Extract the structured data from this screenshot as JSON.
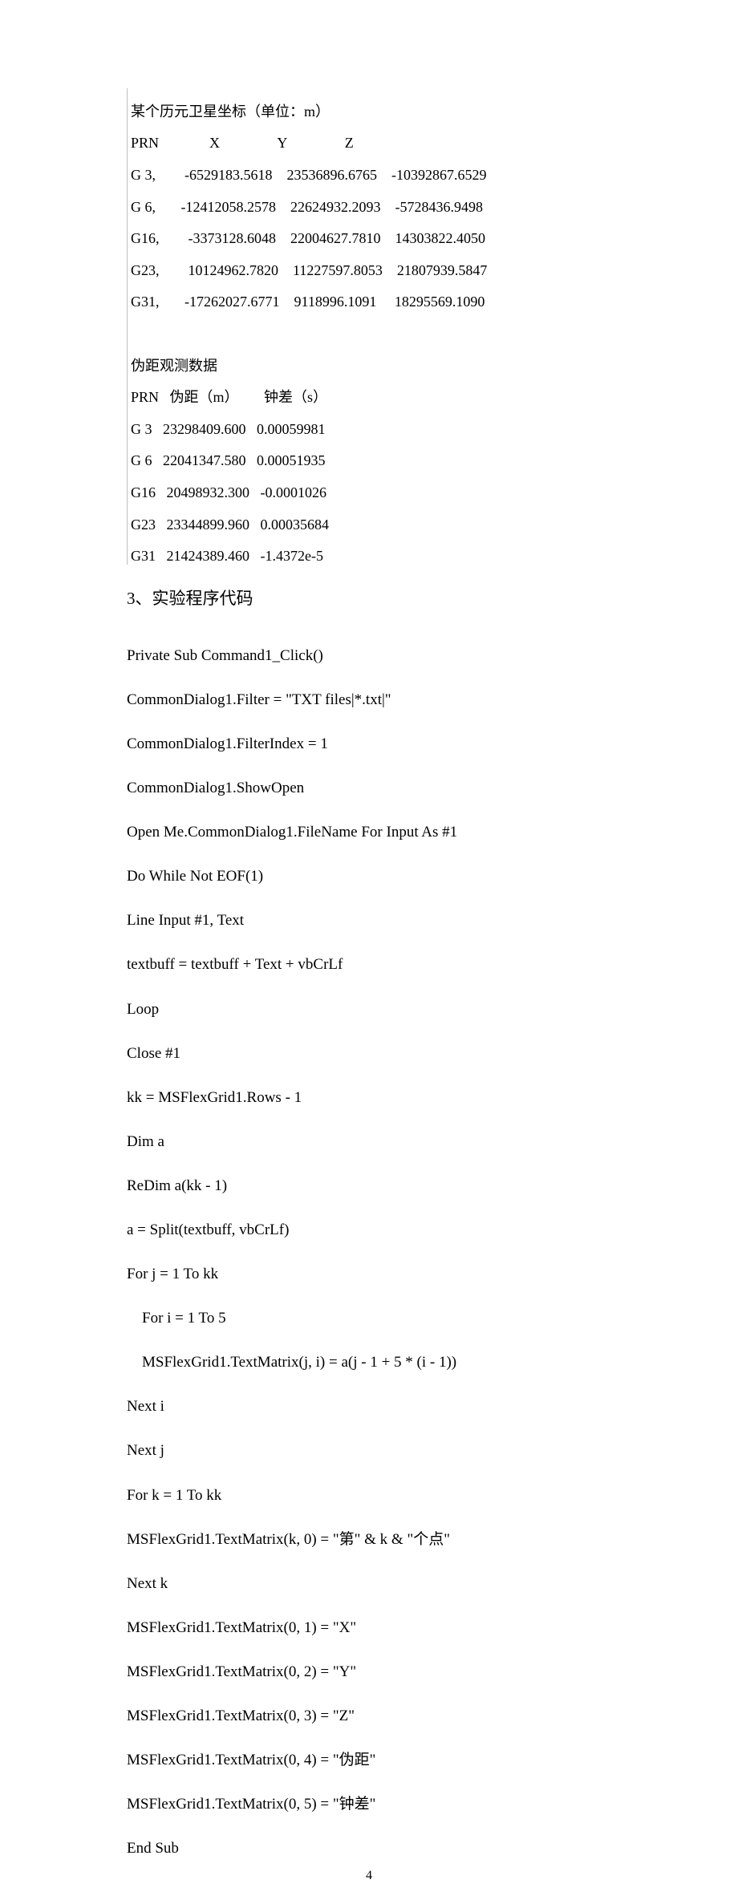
{
  "table1": {
    "title": "某个历元卫星坐标（单位：m）",
    "header": {
      "prn": "PRN",
      "x": "X",
      "y": "Y",
      "z": "Z"
    },
    "rows": [
      {
        "prn": "G 3,",
        "x": "-6529183.5618",
        "y": "23536896.6765",
        "z": "-10392867.6529"
      },
      {
        "prn": "G 6,",
        "x": "-12412058.2578",
        "y": "22624932.2093",
        "z": "-5728436.9498"
      },
      {
        "prn": "G16,",
        "x": "-3373128.6048",
        "y": "22004627.7810",
        "z": "14303822.4050"
      },
      {
        "prn": "G23,",
        "x": "10124962.7820",
        "y": "11227597.8053",
        "z": "21807939.5847"
      },
      {
        "prn": "G31,",
        "x": "-17262027.6771",
        "y": "9118996.1091",
        "z": "18295569.1090"
      }
    ]
  },
  "table2": {
    "title": "伪距观测数据",
    "header": {
      "prn": "PRN",
      "r": "伪距（m）",
      "c": "钟差（s）"
    },
    "rows": [
      {
        "prn": "G 3",
        "r": "23298409.600",
        "c": "0.00059981"
      },
      {
        "prn": "G 6",
        "r": "22041347.580",
        "c": "0.00051935"
      },
      {
        "prn": "G16",
        "r": "20498932.300",
        "c": "-0.0001026"
      },
      {
        "prn": "G23",
        "r": "23344899.960",
        "c": "0.00035684"
      },
      {
        "prn": "G31",
        "r": "21424389.460",
        "c": "-1.4372e-5"
      }
    ]
  },
  "section_heading": "3、实验程序代码",
  "code": [
    "Private Sub Command1_Click()",
    "CommonDialog1.Filter = \"TXT files|*.txt|\"",
    "CommonDialog1.FilterIndex = 1",
    "CommonDialog1.ShowOpen",
    "Open Me.CommonDialog1.FileName For Input As #1",
    "Do While Not EOF(1)",
    "Line Input #1, Text",
    "textbuff = textbuff + Text + vbCrLf",
    "Loop",
    "Close #1",
    "kk = MSFlexGrid1.Rows - 1",
    "Dim a",
    "ReDim a(kk - 1)",
    "a = Split(textbuff, vbCrLf)",
    "For j = 1 To kk",
    "    For i = 1 To 5",
    "    MSFlexGrid1.TextMatrix(j, i) = a(j - 1 + 5 * (i - 1))",
    "Next i",
    "Next j",
    "For k = 1 To kk",
    "MSFlexGrid1.TextMatrix(k, 0) = \"第\" & k & \"个点\"",
    "Next k",
    "MSFlexGrid1.TextMatrix(0, 1) = \"X\"",
    "MSFlexGrid1.TextMatrix(0, 2) = \"Y\"",
    "MSFlexGrid1.TextMatrix(0, 3) = \"Z\"",
    "MSFlexGrid1.TextMatrix(0, 4) = \"伪距\"",
    "MSFlexGrid1.TextMatrix(0, 5) = \"钟差\"",
    "End Sub"
  ],
  "page_number": "4"
}
